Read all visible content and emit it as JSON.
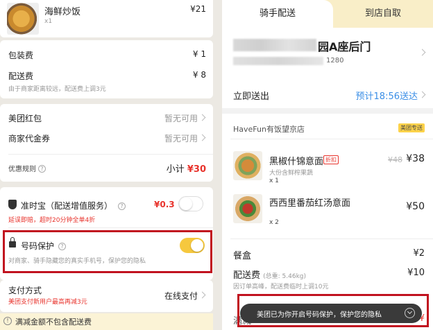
{
  "left": {
    "item": {
      "name": "海鲜炒饭",
      "qty": "x1",
      "price": "¥21"
    },
    "packing": {
      "label": "包装费",
      "value": "¥ 1"
    },
    "delivery": {
      "label": "配送费",
      "value": "¥ 8",
      "note": "由于商家距离较远，配送费上调3元"
    },
    "redpacket": {
      "label": "美团红包",
      "value": "暂无可用"
    },
    "voucher": {
      "label": "商家代金券",
      "value": "暂无可用"
    },
    "promo": {
      "label": "优惠规则",
      "qmark": "?",
      "subtotal_label": "小计",
      "subtotal_value": "¥30"
    },
    "insurance": {
      "title": "准时宝（配送增值服务）",
      "qmark": "?",
      "price": "¥0.3",
      "desc": "延误即赔，超时20分钟全单4折"
    },
    "privacy": {
      "title": "号码保护",
      "qmark": "?",
      "desc": "对商家、骑手隐藏您的真实手机号，保护您的隐私"
    },
    "payment": {
      "label": "支付方式",
      "value": "在线支付",
      "promo": "美团支付新用户最高再减3元"
    },
    "notice": {
      "icon_symbol": "!",
      "text": "满减金额不包含配送费"
    }
  },
  "right": {
    "tabs": {
      "delivery": "骑手配送",
      "pickup": "到店自取"
    },
    "address": {
      "title": "园A座后门",
      "phone": "1280"
    },
    "send_time": {
      "label": "立即送出",
      "value": "预计18:56送达"
    },
    "shop": {
      "name": "HaveFun有饭望京店",
      "badge": "美团专送"
    },
    "dishes": [
      {
        "name": "黑椒什锦意面",
        "tag": "折扣",
        "sub": "大份含鲜榨果蔬",
        "qty": "x 1",
        "orig": "¥48",
        "price": "¥38"
      },
      {
        "name": "西西里番茄红汤意面",
        "qty": "x 2",
        "price": "¥50"
      }
    ],
    "box": {
      "label": "餐盒",
      "value": "¥2"
    },
    "delivery": {
      "label": "配送费",
      "weight": "(总重: 5.46kg)",
      "value": "¥10",
      "note": "因订单高峰，配送费临时上调10元"
    },
    "toast": {
      "text": "美团已为你开启号码保护，保护您的隐私",
      "bottom_left": "满减",
      "bottom_right": "-¥"
    }
  },
  "colors": {
    "accent_red": "#e8332c",
    "brand_yellow": "#fcd24a",
    "blue": "#3a8ee6",
    "highlight_box": "#c1121f"
  }
}
